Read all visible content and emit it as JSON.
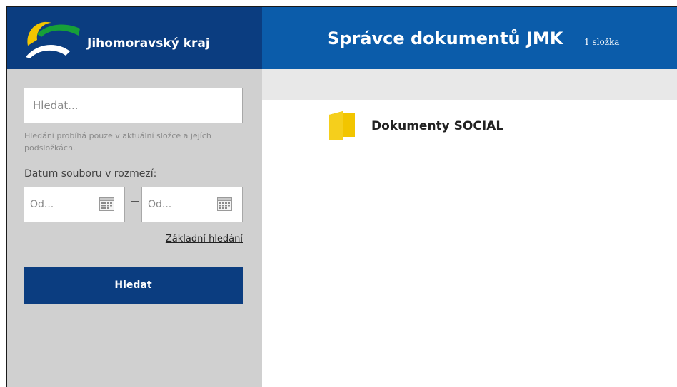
{
  "brand": {
    "name": "Jihomoravský kraj",
    "colors": {
      "dark_blue": "#0b3d80",
      "header_blue": "#0b5caa",
      "logo_yellow": "#f2c500",
      "logo_green": "#17a038",
      "folder_yellow": "#f2c500"
    }
  },
  "header": {
    "title": "Správce dokumentů JMK",
    "count": "1 složka"
  },
  "search": {
    "placeholder": "Hledat...",
    "hint": "Hledání probíhá pouze v aktuální složce a jejích podsložkách.",
    "date_label": "Datum souboru v rozmezí:",
    "date_from_placeholder": "Od...",
    "date_to_placeholder": "Od...",
    "calendar_icon": "calendar-icon",
    "basic_search_link": "Základní hledání",
    "button_label": "Hledat"
  },
  "folders": [
    {
      "name": "Dokumenty SOCIAL",
      "icon": "folder-icon"
    }
  ]
}
